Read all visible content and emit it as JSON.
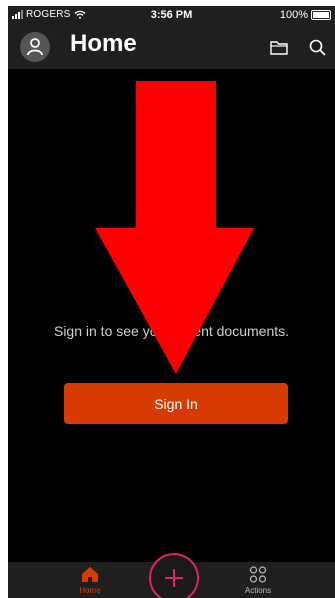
{
  "status_bar": {
    "carrier": "ROGERS",
    "time": "3:56 PM",
    "battery": "100%"
  },
  "header": {
    "title": "Home",
    "profile_icon": "person-icon",
    "folder_icon": "folder-icon",
    "search_icon": "search-icon"
  },
  "main": {
    "empty_message": "Sign in to see your recent documents.",
    "sign_in_label": "Sign In"
  },
  "tab_bar": {
    "home_label": "Home",
    "actions_label": "Actions",
    "create_icon": "plus-icon"
  },
  "colors": {
    "accent": "#d83b01",
    "background": "#000000",
    "bar": "#1f1f1f",
    "arrow": "#ff0000",
    "fab_ring": "#e0245e"
  }
}
